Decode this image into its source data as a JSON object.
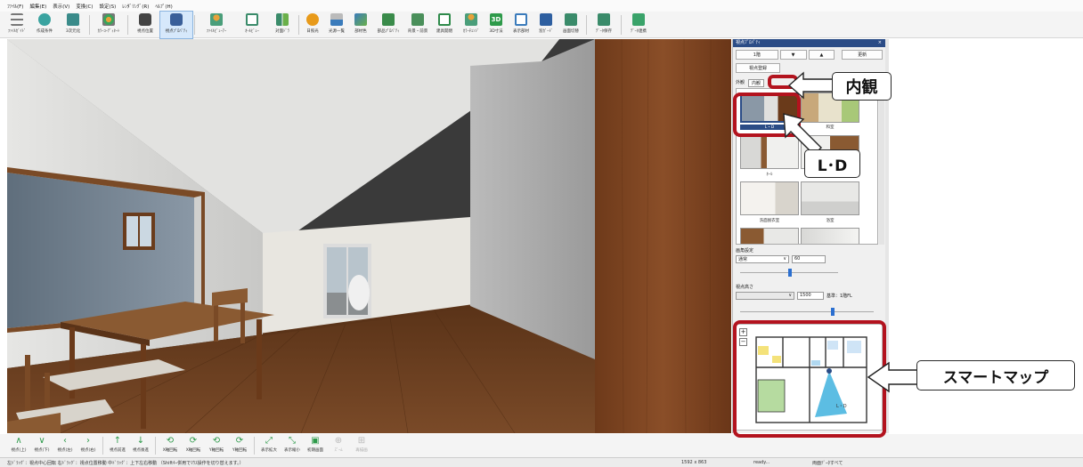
{
  "menu": [
    "ﾌｧｲﾙ(F)",
    "編集(E)",
    "表示(V)",
    "変換(C)",
    "設定(S)",
    "ﾚﾝﾀﾞﾘﾝｸﾞ(R)",
    "ﾍﾙﾌﾟ(H)"
  ],
  "toolbar": [
    {
      "label": "ﾌｧｲﾙｶﾞｲﾄﾞ",
      "icon": "menu-icon"
    },
    {
      "label": "作成条件",
      "icon": "settings-icon"
    },
    {
      "label": "3次元化",
      "icon": "house-icon"
    },
    {
      "label": "ｶﾗｰｺｰﾃﾞｨﾈｰﾄ",
      "icon": "palette-icon"
    },
    {
      "label": "視点位置",
      "icon": "camera-icon"
    },
    {
      "label": "視点ﾌﾟﾛﾊﾟﾃｨ",
      "icon": "camera-properties-icon",
      "active": true
    },
    {
      "label": "ﾌｧｲﾙﾋﾞｭｰｱｰ",
      "icon": "person-icon"
    },
    {
      "label": "ｵｰﾙﾋﾞｭｰ",
      "icon": "window-icon"
    },
    {
      "label": "対面ﾄﾞﾗ",
      "icon": "people-icon"
    },
    {
      "label": "日照光",
      "icon": "sun-icon"
    },
    {
      "label": "光源一覧",
      "icon": "lamp-icon"
    },
    {
      "label": "部材色",
      "icon": "material-icon"
    },
    {
      "label": "部品ﾌﾟﾛﾊﾟﾃｨ",
      "icon": "parts-icon"
    },
    {
      "label": "背景・前景",
      "icon": "background-icon"
    },
    {
      "label": "建具開閉",
      "icon": "door-icon"
    },
    {
      "label": "ｶﾗｰﾁｪﾝｼﾞ",
      "icon": "color-change-icon"
    },
    {
      "label": "3D寸法",
      "icon": "3d-icon"
    },
    {
      "label": "表示部材",
      "icon": "display-icon"
    },
    {
      "label": "窓ｶﾞｰﾄﾞ",
      "icon": "window-guard-icon"
    },
    {
      "label": "画面切替",
      "icon": "switch-icon"
    },
    {
      "label": "ﾃﾞｰﾀ保存",
      "icon": "save-icon"
    },
    {
      "label": "ﾃﾞｰﾀ連携",
      "icon": "link-icon"
    }
  ],
  "panel": {
    "title": "視点ﾌﾟﾛﾊﾟﾃｨ",
    "close": "×",
    "floor": "1階",
    "update": "更新",
    "viewpoint_register": "視点登録",
    "tab_exterior": "外観",
    "tab_interior": "内観",
    "thumbnails": [
      "L・D",
      "和室",
      "ﾎｰﾙ",
      "",
      "洗面脱衣室",
      "浴室"
    ],
    "fov_label": "画角設定",
    "fov_mode": "通常",
    "fov_value": "60",
    "height_label": "視点高さ",
    "height_value": "1500",
    "height_unit": "基準：1階FL",
    "zoom_in": "+",
    "zoom_out": "−",
    "map_room": "L・D"
  },
  "bottombar": [
    {
      "glyph": "∧",
      "label": "視点(上)"
    },
    {
      "glyph": "∨",
      "label": "視点(下)"
    },
    {
      "glyph": "‹",
      "label": "視点(左)"
    },
    {
      "glyph": "›",
      "label": "視点(右)"
    },
    {
      "glyph": "↑",
      "label": "視点前進"
    },
    {
      "glyph": "↓",
      "label": "視点後進"
    },
    {
      "glyph": "⟲",
      "label": "X軸回転"
    },
    {
      "glyph": "⟳",
      "label": "X軸回転"
    },
    {
      "glyph": "⟲",
      "label": "Y軸回転"
    },
    {
      "glyph": "⟳",
      "label": "Y軸回転"
    },
    {
      "glyph": "⤢",
      "label": "表示拡大"
    },
    {
      "glyph": "⤡",
      "label": "表示縮小"
    },
    {
      "glyph": "▣",
      "label": "初期画面"
    },
    {
      "glyph": "⊕",
      "label": "ｽﾞｰﾑ"
    },
    {
      "glyph": "⊞",
      "label": "再描画"
    }
  ],
  "status": {
    "hint": "左ﾄﾞﾗｯｸﾞ：視点中心回転 右ﾄﾞﾗｯｸﾞ：視点位置移動 中ﾄﾞﾗｯｸﾞ：上下左右移動 （Shiftｷｰ併用でﾏｳｽ操作を切り替えます。）",
    "size": "1592 x 863",
    "state": "ready...",
    "mode": "両面ﾃﾞｰﾀすべて"
  },
  "callouts": {
    "interior": "内観",
    "ld": "L･D",
    "smartmap": "スマートマップ"
  },
  "colors": {
    "accent": "#b3131e",
    "panel_title": "#2b4c86",
    "icon_green": "#2d9a4a"
  }
}
